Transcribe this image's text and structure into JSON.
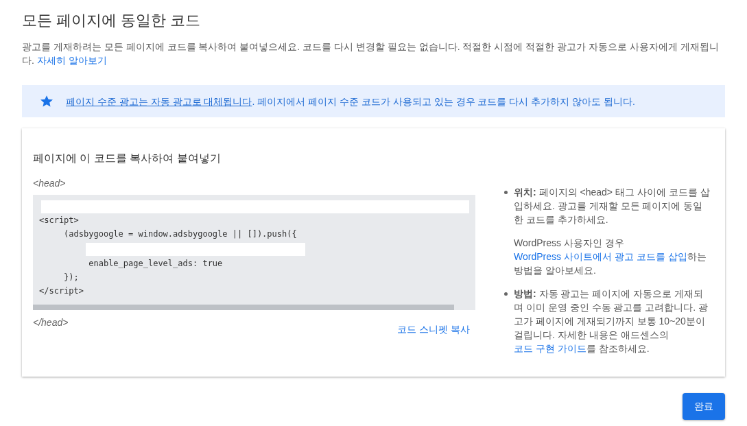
{
  "header": {
    "title": "모든 페이지에 동일한 코드",
    "description": [
      {
        "text": "광고를 게재하려는 모든 페이지에 코드를 복사하여 붙여넣으세요. 코드를 다시 변경할 필요는 없습니다. 적절한 시점에 적절한 광고가 자동으로 사용자에게 게재됩니다. ",
        "link": false
      },
      {
        "text": "자세히 알아보기",
        "link": true
      }
    ]
  },
  "notice": {
    "segments": [
      {
        "text": "페이지 수준 광고는 자동 광고로 대체됩니다",
        "link": true
      },
      {
        "text": ". 페이지에서 페이지 수준 코드가 사용되고 있는 경우 코드를 다시 추가하지 않아도 됩니다.",
        "link": false
      }
    ]
  },
  "code_card": {
    "heading": "페이지에 이 코드를 복사하여 붙여넣기",
    "open_tag": "<head>",
    "code_lines": [
      {
        "kind": "masked_full"
      },
      {
        "kind": "code",
        "text": "<script>"
      },
      {
        "kind": "code",
        "text": "     (adsbygoogle = window.adsbygoogle || []).push({"
      },
      {
        "kind": "masked_indented"
      },
      {
        "kind": "code",
        "text": "          enable_page_level_ads: true"
      },
      {
        "kind": "code",
        "text": "     });"
      },
      {
        "kind": "code",
        "text": "</script>"
      }
    ],
    "close_tag": "</head>",
    "copy_link": "코드 스니펫 복사",
    "notes": [
      {
        "paragraphs": [
          {
            "segments": [
              {
                "text": "**위치:** 페이지의 <head> 태그 사이에 코드를 삽입하세요. 광고를 게재할 모든 페이지에 동일한 코드를 추가하세요.",
                "link": false
              }
            ]
          },
          {
            "segments": [
              {
                "text": "WordPress 사용자인 경우 ",
                "link": false
              },
              {
                "text": "WordPress 사이트에서 광고 코드를 삽입",
                "link": true
              },
              {
                "text": "하는 방법을 알아보세요.",
                "link": false
              }
            ]
          }
        ]
      },
      {
        "paragraphs": [
          {
            "segments": [
              {
                "text": "**방법:** 자동 광고는 페이지에 자동으로 게재되며 이미 운영 중인 수동 광고를 고려합니다. 광고가 페이지에 게재되기까지 보통 10~20분이 걸립니다. 자세한 내용은 애드센스의 ",
                "link": false
              },
              {
                "text": "코드 구현 가이드",
                "link": true
              },
              {
                "text": "를 참조하세요.",
                "link": false
              }
            ]
          }
        ]
      }
    ]
  },
  "buttons": [
    {
      "label": "완료"
    }
  ]
}
